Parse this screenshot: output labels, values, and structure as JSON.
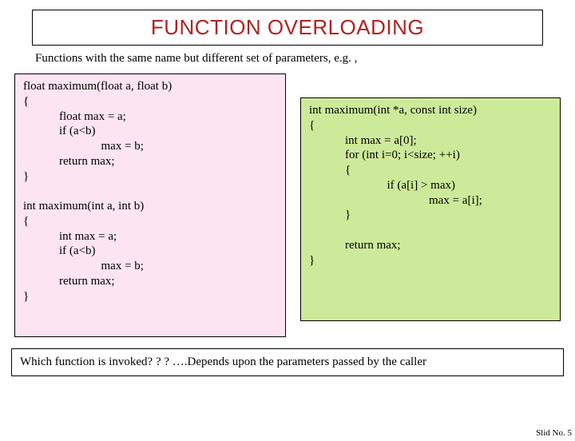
{
  "title": "FUNCTION OVERLOADING",
  "intro": "Functions with the same name but different set of parameters, e.g. ,",
  "left_code": "float maximum(float a, float b)\n{\n            float max = a;\n            if (a<b)\n                          max = b;\n            return max;\n}\n\nint maximum(int a, int b)\n{\n            int max = a;\n            if (a<b)\n                          max = b;\n            return max;\n}",
  "right_code": "int maximum(int *a, const int size)\n{\n            int max = a[0];\n            for (int i=0; i<size; ++i)\n            {\n                          if (a[i] > max)\n                                        max = a[i];\n            }\n\n            return max;\n}",
  "footer": "Which function is invoked? ? ? ….Depends upon the parameters passed by the caller",
  "slideno": "Slid No. 5"
}
